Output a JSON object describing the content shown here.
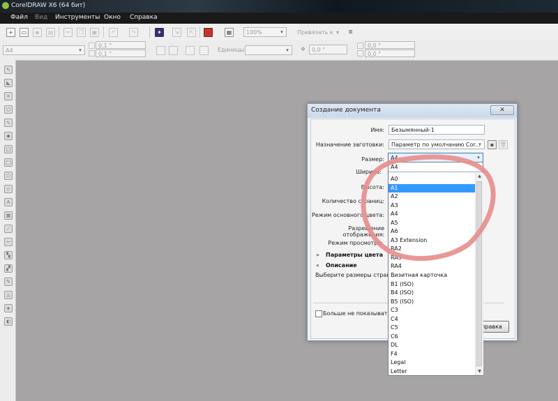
{
  "app": {
    "title": "CorelDRAW X6 (64 бит)"
  },
  "menu": [
    "Файл",
    "Вид",
    "Инструменты",
    "Окно",
    "Справка"
  ],
  "menu_disabled": [
    false,
    true,
    false,
    false,
    false
  ],
  "toolbar": {
    "zoom_value": "100%",
    "snap_label": "Привязать к"
  },
  "propbar": {
    "page_size": "A4",
    "width_value": "0,1 \"",
    "height_value": "0,1 \"",
    "units_label": "Единицы:",
    "nudge_value": "0,0 \"",
    "dup_x": "0,0 \"",
    "dup_y": "0,0 \""
  },
  "dialog": {
    "title": "Создание документа",
    "close": "✕",
    "name_label": "Имя:",
    "name_value": "Безымянный-1",
    "preset_label": "Назначение заготовки:",
    "preset_value": "Параметр по умолчанию Cor...",
    "size_label": "Размер:",
    "width_label": "Ширина:",
    "height_label": "Высота:",
    "pages_label": "Количество страниц:",
    "colormode_label": "Режим основного цвета:",
    "resolution_label": "Разрешение отображения:",
    "preview_label": "Режим просмотра:",
    "color_section": "Параметры цвета",
    "desc_section": "Описание",
    "desc_text": "Выберите размеры страниц",
    "dontshow_label": "Больше не показывать эт",
    "help_button": "правка"
  },
  "size_dropdown": {
    "selected": "A4",
    "header_value": "A4",
    "highlighted": "A1",
    "items": [
      "A0",
      "A1",
      "A2",
      "A3",
      "A4",
      "A5",
      "A6",
      "A3 Extension",
      "RA2",
      "RA3",
      "RA4",
      "Визитная карточка",
      "B1 (ISO)",
      "B4 (ISO)",
      "B5 (ISO)",
      "C3",
      "C4",
      "C5",
      "C6",
      "DL",
      "F4",
      "Legal",
      "Letter"
    ]
  },
  "colors": {
    "canvas": "#a6a4a4",
    "highlight": "#3399ff",
    "annotation": "#e88c8c"
  }
}
